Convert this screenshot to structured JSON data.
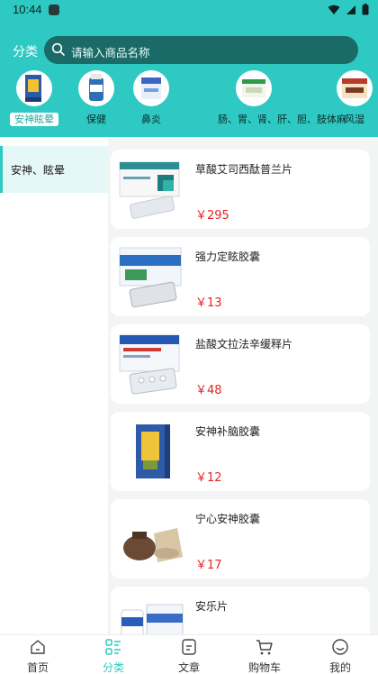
{
  "status_bar": {
    "time": "10:44"
  },
  "header": {
    "title": "分类",
    "search_placeholder": "请输入商品名称"
  },
  "categories": [
    {
      "label": "安神眩晕",
      "active": true
    },
    {
      "label": "保健",
      "active": false
    },
    {
      "label": "鼻炎",
      "active": false
    },
    {
      "label": "肠、胃、肾、肝、胆、肢体麻",
      "active": false
    },
    {
      "label": "风湿",
      "active": false
    }
  ],
  "sidebar": {
    "items": [
      {
        "label": "安神、眩晕",
        "active": true
      }
    ]
  },
  "products": [
    {
      "name": "草酸艾司西酞普兰片",
      "price": "￥295"
    },
    {
      "name": "强力定眩胶囊",
      "price": "￥13"
    },
    {
      "name": "盐酸文拉法辛缓释片",
      "price": "￥48"
    },
    {
      "name": "安神补脑胶囊",
      "price": "￥12"
    },
    {
      "name": "宁心安神胶囊",
      "price": "￥17"
    },
    {
      "name": "安乐片",
      "price": ""
    }
  ],
  "bottom_nav": [
    {
      "label": "首页",
      "icon": "home-icon",
      "active": false
    },
    {
      "label": "分类",
      "icon": "category-icon",
      "active": true
    },
    {
      "label": "文章",
      "icon": "article-icon",
      "active": false
    },
    {
      "label": "购物车",
      "icon": "cart-icon",
      "active": false
    },
    {
      "label": "我的",
      "icon": "profile-icon",
      "active": false
    }
  ],
  "colors": {
    "accent": "#2ec9c2",
    "search_bg": "#1a6b68",
    "price": "#e52424"
  }
}
